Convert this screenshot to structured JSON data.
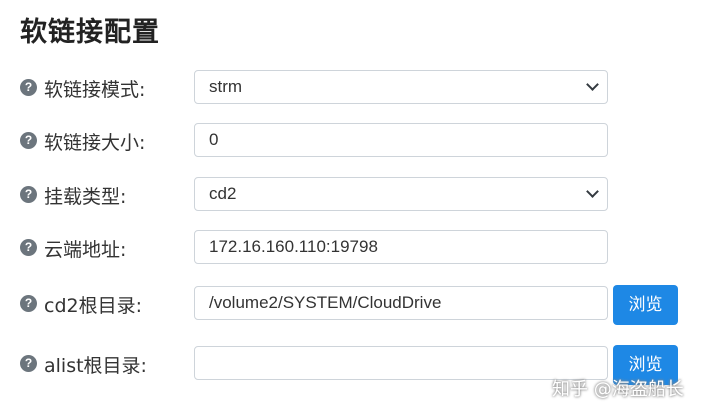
{
  "page": {
    "title": "软链接配置"
  },
  "fields": [
    {
      "label": "软链接模式:",
      "value": "strm",
      "kind": "select"
    },
    {
      "label": "软链接大小:",
      "value": "0",
      "kind": "input"
    },
    {
      "label": "挂载类型:",
      "value": "cd2",
      "kind": "select"
    },
    {
      "label": "云端地址:",
      "value": "172.16.160.110:19798",
      "kind": "input"
    },
    {
      "label": "cd2根目录:",
      "value": "/volume2/SYSTEM/CloudDrive",
      "kind": "input",
      "button": "浏览"
    },
    {
      "label": "alist根目录:",
      "value": "",
      "kind": "input",
      "button": "浏览"
    }
  ],
  "help_glyph": "?",
  "watermark": "知乎 @海盗船长"
}
